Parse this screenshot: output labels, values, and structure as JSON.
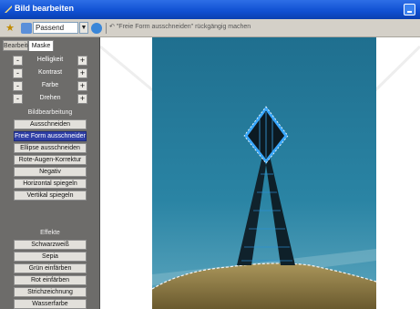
{
  "window": {
    "title": "Bild bearbeiten"
  },
  "toolbar": {
    "zoom_value": "Passend",
    "undo_text": "\"Freie Form ausschneiden\" rückgängig machen"
  },
  "sidebar": {
    "tabs": [
      {
        "label": "Bearbeiten"
      },
      {
        "label": "Maske"
      }
    ],
    "adjustments": [
      {
        "label": "Helligkeit",
        "minus": "-",
        "plus": "+"
      },
      {
        "label": "Kontrast",
        "minus": "-",
        "plus": "+"
      },
      {
        "label": "Farbe",
        "minus": "-",
        "plus": "+"
      },
      {
        "label": "Drehen",
        "minus": "-",
        "plus": "+"
      }
    ],
    "editing_title": "Bildbearbeitung",
    "editing_buttons": [
      "Ausschneiden",
      "Freie Form ausschneiden",
      "Ellipse ausschneiden",
      "Rote-Augen-Korrektur",
      "Negativ",
      "Horizontal spiegeln",
      "Vertikal spiegeln"
    ],
    "active_button": "Freie Form ausschneiden",
    "effects_title": "Effekte",
    "effects_buttons": [
      "Schwarzweiß",
      "Sepia",
      "Grün einfärben",
      "Rot einfärben",
      "Strichzeichnung",
      "Wasserfarbe"
    ]
  },
  "colors": {
    "titlebar": "#0f4fd1",
    "sidebar": "#6d6c6a",
    "active_button": "#2f3fa6",
    "sky": "#2a7d9c",
    "selection_highlight": "#39a8ff"
  },
  "icons": [
    "app-icon",
    "star-icon",
    "zoom-icon",
    "go-icon",
    "undo-icon",
    "minimize-icon"
  ]
}
